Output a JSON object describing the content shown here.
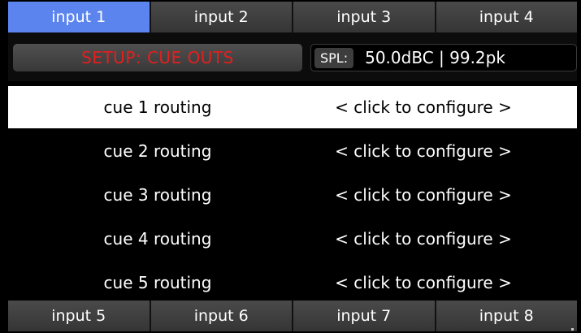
{
  "top_tabs": [
    {
      "label": "input 1",
      "active": true
    },
    {
      "label": "input 2",
      "active": false
    },
    {
      "label": "input 3",
      "active": false
    },
    {
      "label": "input 4",
      "active": false
    }
  ],
  "setup": {
    "title": "SETUP: CUE OUTS",
    "spl_label": "SPL:",
    "spl_value": "50.0dBC | 99.2pk"
  },
  "routes": [
    {
      "label": "cue 1 routing",
      "action": "< click to configure >",
      "selected": true
    },
    {
      "label": "cue 2 routing",
      "action": "< click to configure >",
      "selected": false
    },
    {
      "label": "cue 3 routing",
      "action": "< click to configure >",
      "selected": false
    },
    {
      "label": "cue 4 routing",
      "action": "< click to configure >",
      "selected": false
    },
    {
      "label": "cue 5 routing",
      "action": "< click to configure >",
      "selected": false
    }
  ],
  "bottom_tabs": [
    {
      "label": "input 5"
    },
    {
      "label": "input 6"
    },
    {
      "label": "input 7"
    },
    {
      "label": "input 8"
    }
  ],
  "colors": {
    "active_tab": "#5b84ee",
    "setup_title": "#e61e1e",
    "selected_row": "#ffffff"
  }
}
